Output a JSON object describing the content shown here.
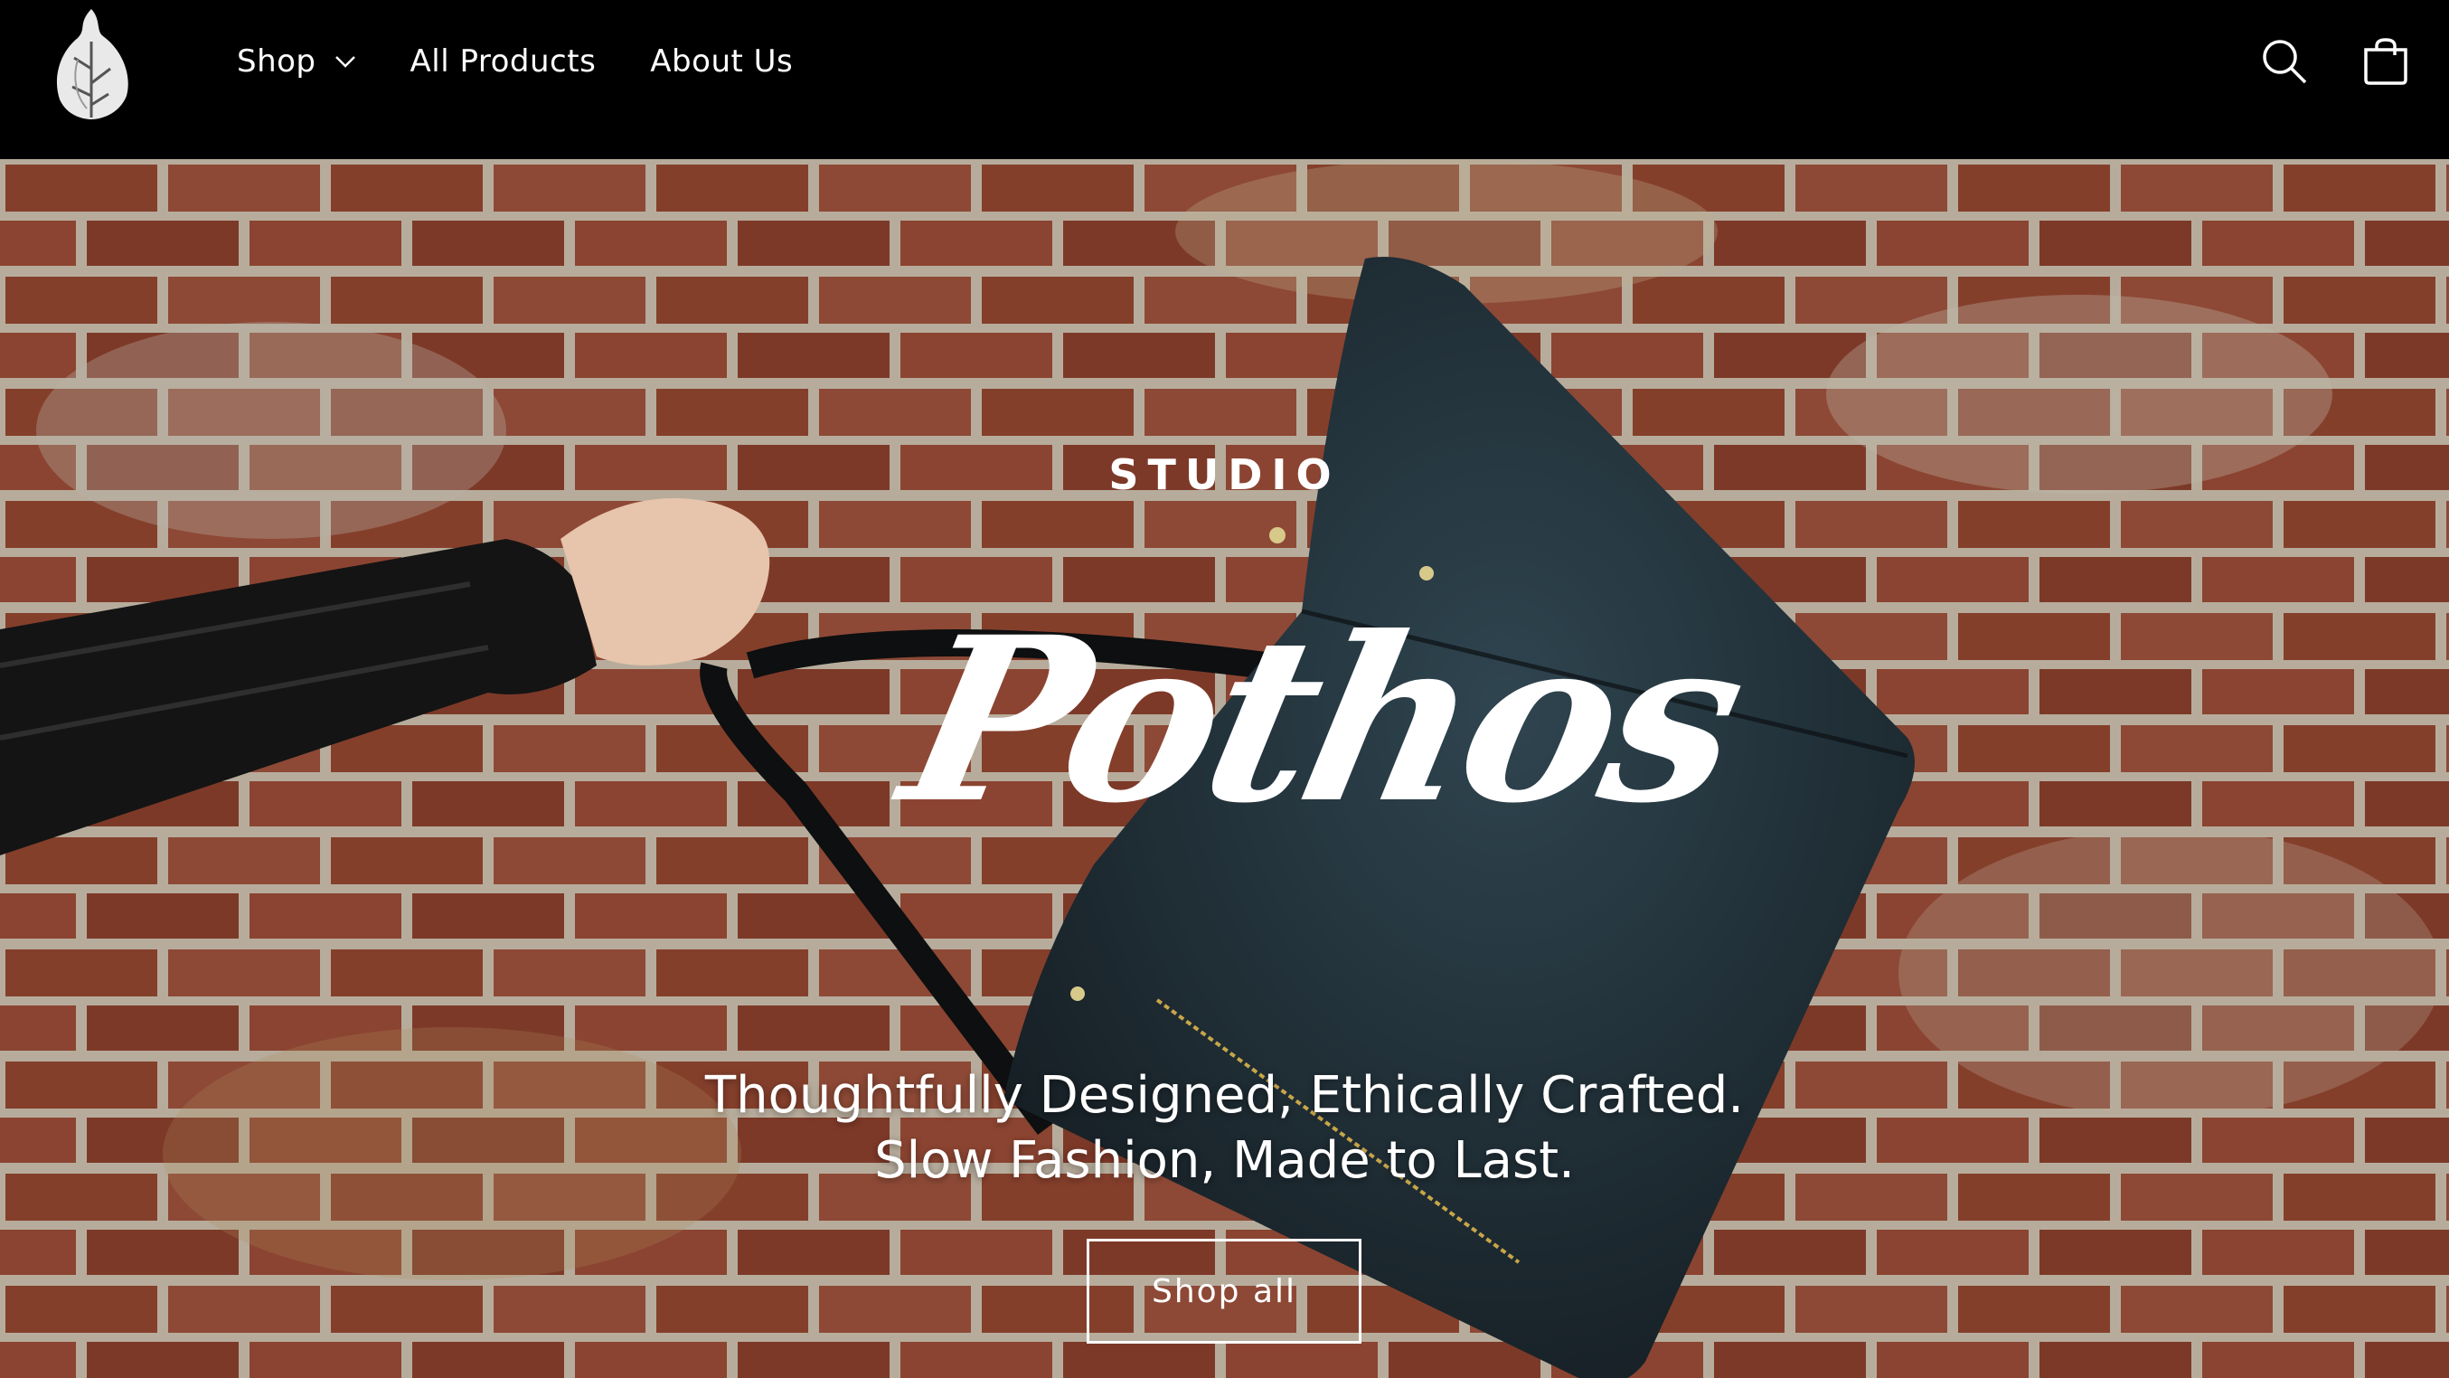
{
  "header": {
    "logo": "leaf-logo",
    "nav": [
      {
        "label": "Shop",
        "has_dropdown": true
      },
      {
        "label": "All Products"
      },
      {
        "label": "About Us"
      }
    ],
    "icons": [
      "search-icon",
      "cart-icon"
    ]
  },
  "hero": {
    "brand_top": "STUDIO",
    "brand_main": "Pothos",
    "tagline_line1": "Thoughtfully Designed, Ethically Crafted.",
    "tagline_line2": "Slow Fashion, Made to Last.",
    "cta_label": "Shop all"
  },
  "colors": {
    "header_bg": "#000000",
    "brick": "#8d4a37",
    "bag": "#1d2a31",
    "text": "#ffffff"
  }
}
